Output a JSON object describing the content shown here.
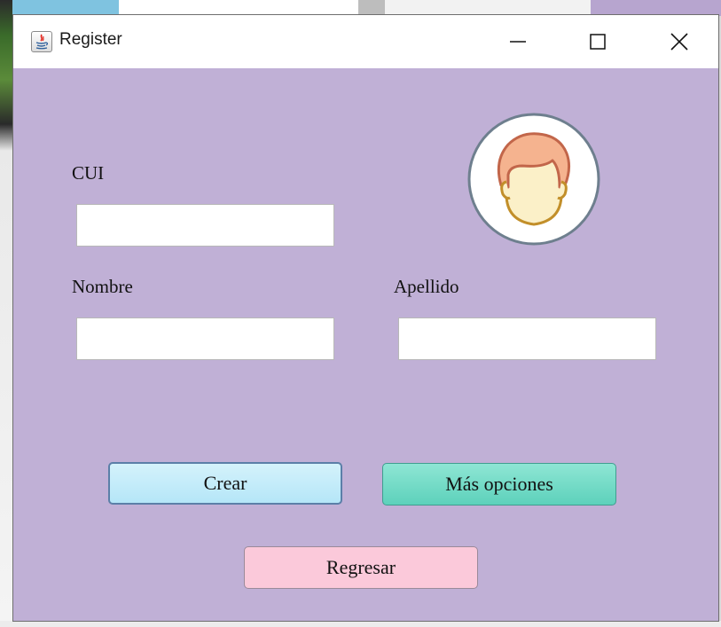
{
  "window": {
    "title": "Register"
  },
  "form": {
    "cui_label": "CUI",
    "cui_value": "",
    "nombre_label": "Nombre",
    "nombre_value": "",
    "apellido_label": "Apellido",
    "apellido_value": ""
  },
  "buttons": {
    "crear": "Crear",
    "mas_opciones": "Más opciones",
    "regresar": "Regresar"
  },
  "colors": {
    "window_bg": "#c0b0d6",
    "crear_bg": "#c4ecfa",
    "mas_opciones_bg": "#6fdac4",
    "regresar_bg": "#fbc9da"
  },
  "icons": {
    "app": "java-icon",
    "avatar": "user-avatar-icon",
    "minimize": "minimize-icon",
    "maximize": "maximize-icon",
    "close": "close-icon"
  }
}
